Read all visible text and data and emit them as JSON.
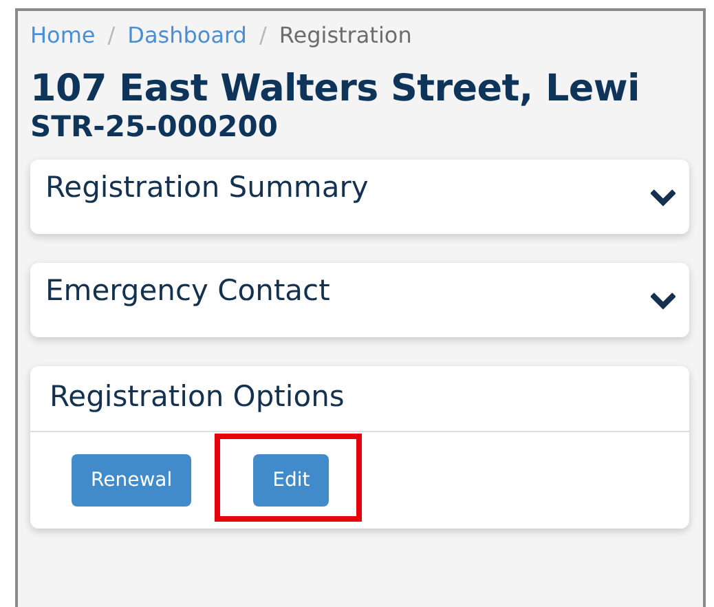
{
  "breadcrumb": [
    {
      "label": "Home",
      "current": false
    },
    {
      "label": "Dashboard",
      "current": false
    },
    {
      "label": "Registration",
      "current": true
    }
  ],
  "breadcrumb_separator": "/",
  "title": "107 East Walters Street, Lewi",
  "subtitle": "STR-25-000200",
  "sections": [
    {
      "title": "Registration Summary",
      "expanded": false
    },
    {
      "title": "Emergency Contact",
      "expanded": false
    },
    {
      "title": "Registration Options",
      "expanded": true,
      "buttons": [
        {
          "label": "Renewal",
          "highlighted": false
        },
        {
          "label": "Edit",
          "highlighted": true
        }
      ]
    }
  ]
}
